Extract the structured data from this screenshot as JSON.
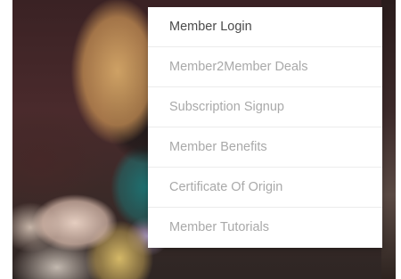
{
  "background": {
    "image_name": "members-event-photo"
  },
  "dropdown": {
    "items": [
      {
        "label": "Member Login",
        "active": true
      },
      {
        "label": "Member2Member Deals",
        "active": false
      },
      {
        "label": "Subscription Signup",
        "active": false
      },
      {
        "label": "Member Benefits",
        "active": false
      },
      {
        "label": "Certificate Of Origin",
        "active": false
      },
      {
        "label": "Member Tutorials",
        "active": false
      }
    ]
  },
  "colors": {
    "item_text": "#a9a9a9",
    "item_text_active": "#4a4a4a",
    "menu_bg": "#ffffff",
    "divider": "#ececec"
  }
}
